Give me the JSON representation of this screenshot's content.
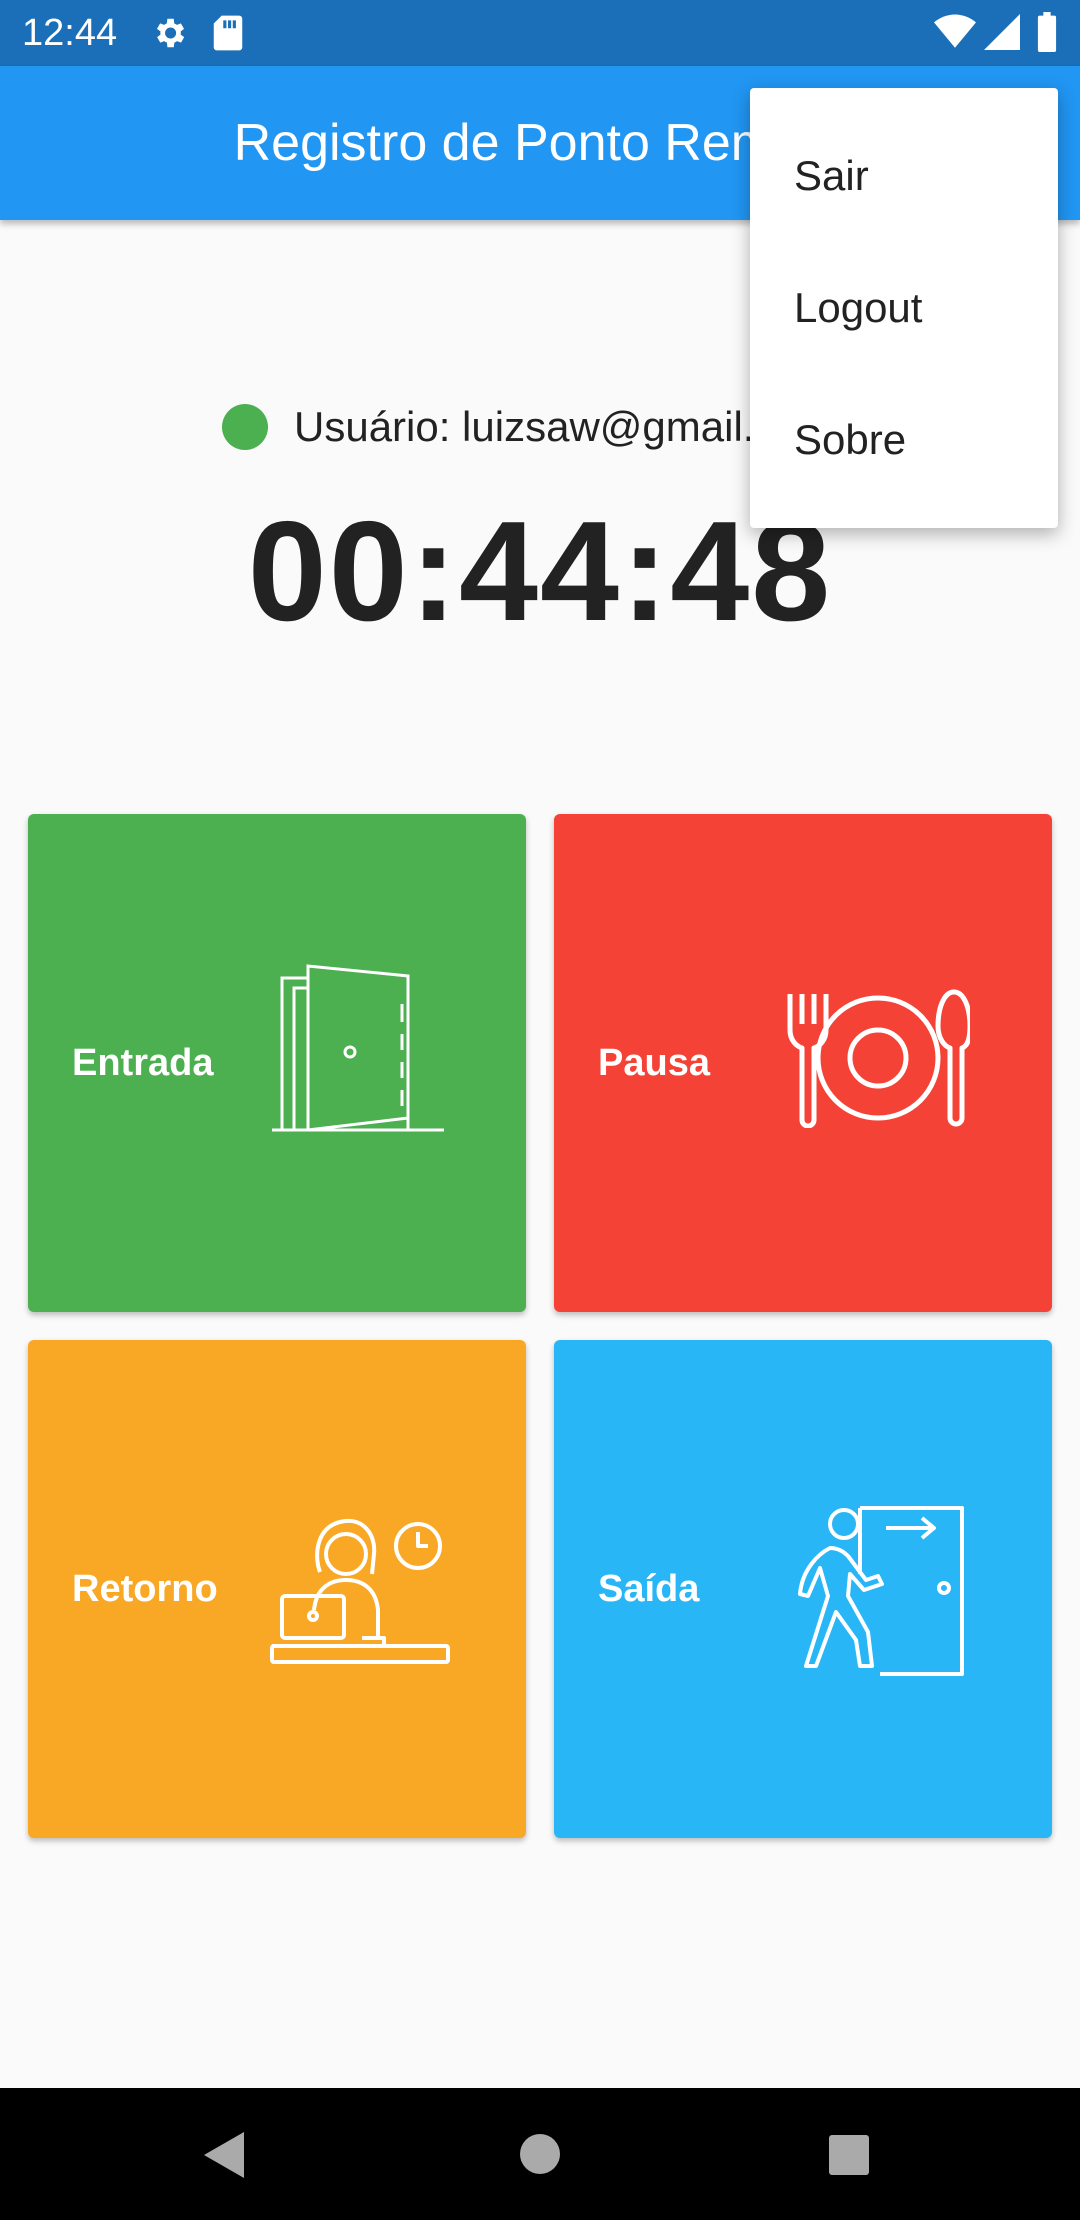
{
  "status_bar": {
    "time": "12:44",
    "icons": [
      "gear-icon",
      "sd-card-icon",
      "wifi-icon",
      "signal-icon",
      "battery-icon"
    ]
  },
  "app_bar": {
    "title": "Registro de Ponto Remoto"
  },
  "user": {
    "label": "Usuário: luizsaw@gmail.com",
    "status_color": "#4caf50"
  },
  "timer": "00:44:48",
  "tiles": [
    {
      "label": "Entrada",
      "color": "#4caf50",
      "icon": "door-icon"
    },
    {
      "label": "Pausa",
      "color": "#f44336",
      "icon": "plate-cutlery-icon"
    },
    {
      "label": "Retorno",
      "color": "#f9a825",
      "icon": "person-laptop-clock-icon"
    },
    {
      "label": "Saída",
      "color": "#29b6f6",
      "icon": "exit-door-icon"
    }
  ],
  "menu": {
    "items": [
      "Sair",
      "Logout",
      "Sobre"
    ]
  },
  "colors": {
    "app_bar": "#2196f3",
    "status_bar": "#1a6fb8"
  },
  "nav_bar": {
    "icons": [
      "back-icon",
      "home-icon",
      "recents-icon"
    ]
  }
}
